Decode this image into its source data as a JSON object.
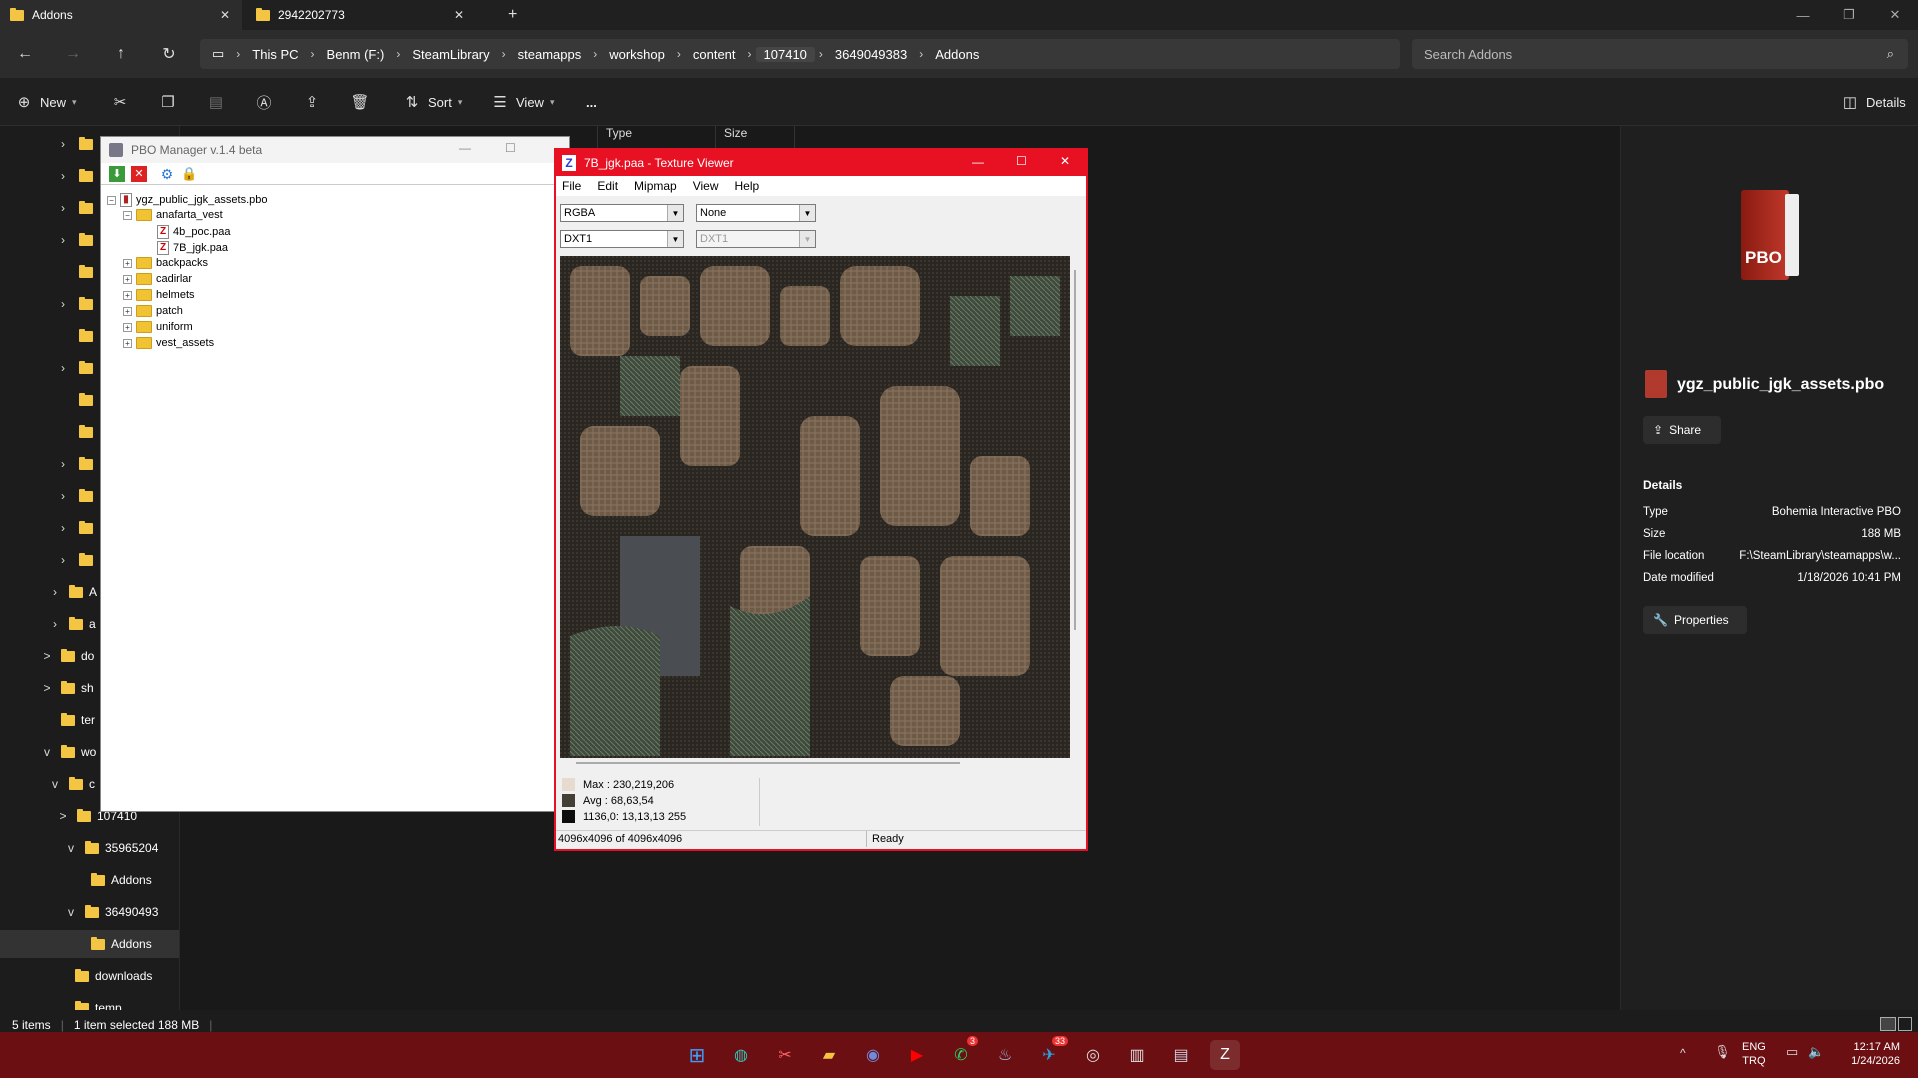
{
  "tabs": [
    {
      "label": "Addons",
      "active": true
    },
    {
      "label": "2942202773",
      "active": false
    }
  ],
  "breadcrumb": [
    "This PC",
    "Benm  (F:)",
    "SteamLibrary",
    "steamapps",
    "workshop",
    "content",
    "107410",
    "3649049383",
    "Addons"
  ],
  "search": {
    "placeholder": "Search Addons"
  },
  "commands": {
    "new": "New",
    "sort": "Sort",
    "view": "View",
    "more": "...",
    "details": "Details"
  },
  "file_list": {
    "headers": [
      "Type",
      "Size"
    ]
  },
  "sidebar": {
    "items": [
      {
        "label": "do",
        "chevron": ">"
      },
      {
        "label": "sh",
        "chevron": ">"
      },
      {
        "label": "ter",
        "chevron": ""
      },
      {
        "label": "wo",
        "chevron": "v"
      },
      {
        "label": "c",
        "chevron": "v"
      },
      {
        "label": "107410",
        "chevron": ">"
      },
      {
        "label": "35965204",
        "chevron": "v"
      },
      {
        "label": "Addons",
        "chevron": ""
      },
      {
        "label": "36490493",
        "chevron": "v"
      },
      {
        "label": "Addons",
        "chevron": ""
      },
      {
        "label": "downloads",
        "chevron": ""
      },
      {
        "label": "temp",
        "chevron": ""
      }
    ],
    "partial": [
      "A",
      "a"
    ]
  },
  "details_pane": {
    "filename": "ygz_public_jgk_assets.pbo",
    "icon_text": "PBO",
    "share": "Share",
    "section": "Details",
    "rows": [
      {
        "key": "Type",
        "value": "Bohemia Interactive PBO"
      },
      {
        "key": "Size",
        "value": "188 MB"
      },
      {
        "key": "File location",
        "value": "F:\\SteamLibrary\\steamapps\\w..."
      },
      {
        "key": "Date modified",
        "value": "1/18/2026 10:41 PM"
      }
    ],
    "properties": "Properties"
  },
  "status": {
    "items": "5 items",
    "selected": "1 item selected  188 MB"
  },
  "pbo_manager": {
    "title": "PBO Manager v.1.4 beta",
    "root": "ygz_public_jgk_assets.pbo",
    "tree": [
      {
        "label": "anafarta_vest",
        "type": "folder",
        "expanded": true,
        "children": [
          "4b_poc.paa",
          "7B_jgk.paa"
        ]
      },
      {
        "label": "backpacks",
        "type": "folder"
      },
      {
        "label": "cadirlar",
        "type": "folder"
      },
      {
        "label": "helmets",
        "type": "folder"
      },
      {
        "label": "patch",
        "type": "folder"
      },
      {
        "label": "uniform",
        "type": "folder"
      },
      {
        "label": "vest_assets",
        "type": "folder"
      }
    ]
  },
  "texture_viewer": {
    "title": "7B_jgk.paa - Texture Viewer",
    "menu": [
      "File",
      "Edit",
      "Mipmap",
      "View",
      "Help"
    ],
    "channel": "RGBA",
    "filter": "None",
    "format": "DXT1",
    "format2": "DXT1",
    "max": "Max : 230,219,206",
    "avg": "Avg : 68,63,54",
    "pixel": "1136,0: 13,13,13  255",
    "size_status": "4096x4096 of 4096x4096",
    "state": "Ready",
    "colors": {
      "max": "#e6dbce",
      "avg": "#443f36",
      "pixel": "#0d0d0d"
    }
  },
  "taskbar": {
    "lang": "ENG",
    "layout": "TRQ",
    "time": "12:17 AM",
    "date": "1/24/2026",
    "badges": {
      "whatsapp": "3",
      "telegram": "33"
    }
  }
}
